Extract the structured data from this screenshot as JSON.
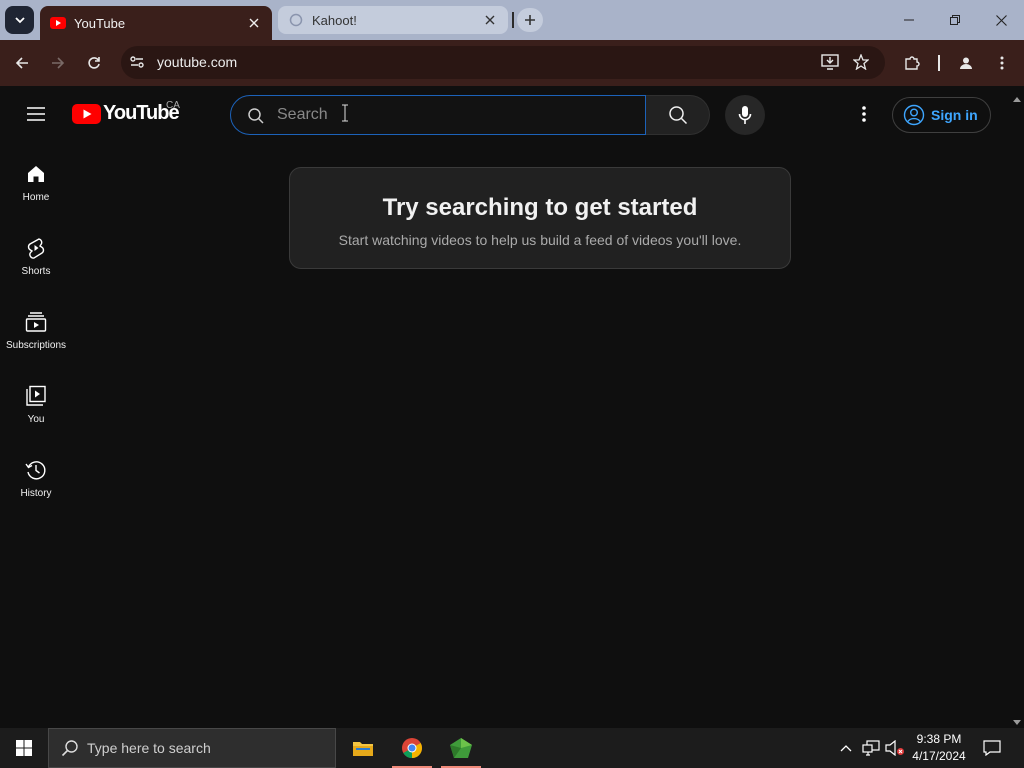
{
  "browser": {
    "tabs": [
      {
        "title": "YouTube",
        "active": true,
        "favicon": "youtube-favicon"
      },
      {
        "title": "Kahoot!",
        "active": false,
        "favicon": "loading-favicon"
      }
    ],
    "url": "youtube.com"
  },
  "header": {
    "logo_text": "YouTube",
    "country_code": "CA",
    "search_placeholder": "Search",
    "signin_label": "Sign in"
  },
  "guide": {
    "items": [
      {
        "label": "Home",
        "icon": "home-icon"
      },
      {
        "label": "Shorts",
        "icon": "shorts-icon"
      },
      {
        "label": "Subscriptions",
        "icon": "subscriptions-icon"
      },
      {
        "label": "You",
        "icon": "you-icon"
      },
      {
        "label": "History",
        "icon": "history-icon"
      }
    ]
  },
  "prompt": {
    "title": "Try searching to get started",
    "subtitle": "Start watching videos to help us build a feed of videos you'll love."
  },
  "taskbar": {
    "search_placeholder": "Type here to search",
    "time": "9:38 PM",
    "date": "4/17/2024"
  },
  "colors": {
    "brand_red": "#ff0000",
    "link_blue": "#3ea6ff",
    "browser_frame": "#3a1f1b",
    "tabstrip": "#a9b3c9"
  }
}
